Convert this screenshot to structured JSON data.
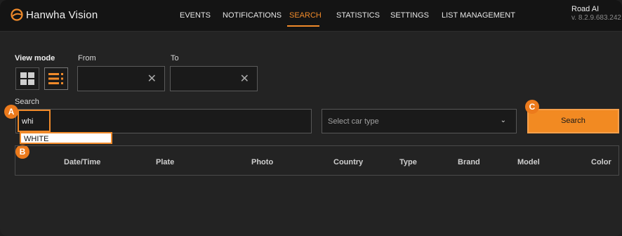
{
  "brand": {
    "logo_text": "Hanwha Vision"
  },
  "nav": {
    "items": [
      "EVENTS",
      "NOTIFICATIONS",
      "SEARCH",
      "STATISTICS",
      "SETTINGS",
      "LIST MANAGEMENT"
    ],
    "active": "SEARCH"
  },
  "user": {
    "name": "Road AI",
    "version": "v. 8.2.9.683.242"
  },
  "filters": {
    "view_mode_label": "View mode",
    "from_label": "From",
    "to_label": "To",
    "search_label": "Search",
    "search_value": "whi",
    "suggestion": "WHITE",
    "car_type_placeholder": "Select car type",
    "search_button": "Search"
  },
  "markers": {
    "a": "A",
    "b": "B",
    "c": "C"
  },
  "table": {
    "columns": [
      "Date/Time",
      "Plate",
      "Photo",
      "Country",
      "Type",
      "Brand",
      "Model",
      "Color"
    ]
  },
  "colors": {
    "accent": "#f08a2a",
    "marker": "#ec7a1c",
    "background": "#232323"
  },
  "icons": [
    "hanwha-logo-icon",
    "grid-view-icon",
    "list-view-icon",
    "clear-icon",
    "chevron-down-icon"
  ]
}
